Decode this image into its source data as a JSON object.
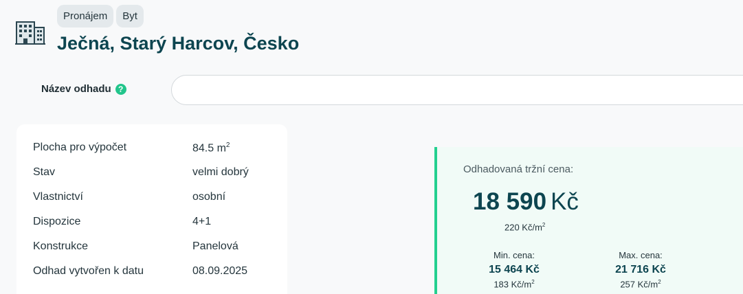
{
  "header": {
    "chips": [
      "Pronájem",
      "Byt"
    ],
    "address": "Ječná, Starý Harcov, Česko"
  },
  "estimate_name": {
    "label": "Název odhadu",
    "help_glyph": "?",
    "value": ""
  },
  "params": [
    {
      "key": "Plocha pro výpočet",
      "value": "84.5 m",
      "sup": "2"
    },
    {
      "key": "Stav",
      "value": "velmi dobrý"
    },
    {
      "key": "Vlastnictví",
      "value": "osobní"
    },
    {
      "key": "Dispozice",
      "value": "4+1"
    },
    {
      "key": "Konstrukce",
      "value": "Panelová"
    },
    {
      "key": "Odhad vytvořen k datu",
      "value": "08.09.2025"
    }
  ],
  "price": {
    "title": "Odhadovaná tržní cena:",
    "amount": "18 590",
    "currency": "Kč",
    "per_sqm": "220 Kč/m",
    "per_sqm_sup": "2",
    "min": {
      "label": "Min. cena:",
      "value": "15 464 Kč",
      "per_sqm": "183 Kč/m",
      "sup": "2"
    },
    "max": {
      "label": "Max. cena:",
      "value": "21 716 Kč",
      "per_sqm": "257 Kč/m",
      "sup": "2"
    }
  },
  "colors": {
    "accent": "#24d08f",
    "brand_dark": "#0d4550"
  },
  "icons": {
    "building": "building-icon",
    "help": "help-icon"
  }
}
